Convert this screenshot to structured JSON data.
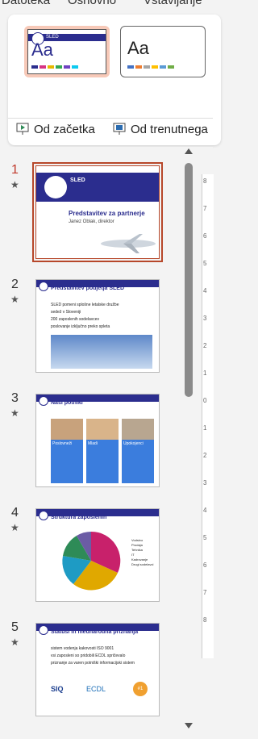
{
  "tabs": [
    "Datoteka",
    "Osnovno",
    "Vstavljanje"
  ],
  "ribbon": {
    "theme1_logo": "SLED",
    "theme_label": "Aa",
    "from_start_label": "Od začetka",
    "from_current_label": "Od trenutnega"
  },
  "colors": {
    "accent": "#2b2d8e",
    "selection": "#b7472a"
  },
  "slides": [
    {
      "num": "1",
      "title": "Predstavitev za partnerje",
      "subtitle": "Janez Oblak, direktor",
      "logo": "SLED"
    },
    {
      "num": "2",
      "title": "Predstavitev podjetja SLED",
      "bullets": [
        "SLED pomeni splošne letalske družbe",
        "sedež v Sloveniji",
        "200 zaposlenih sodelavcev",
        "poslovanje izključno preko spleta"
      ]
    },
    {
      "num": "3",
      "title": "Naši potniki",
      "cards": [
        "Poslovneži",
        "Mladi",
        "Upokojenci"
      ]
    },
    {
      "num": "4",
      "title": "Struktura zaposlenih",
      "legend": [
        "Vodstvo",
        "Prodaja",
        "Tehnika",
        "IT",
        "Kadrovanje",
        "Drugi sodelavci"
      ]
    },
    {
      "num": "5",
      "title": "Statusi in mednarodna priznanja",
      "bullets": [
        "sistem vodenja kakovosti ISO 9001",
        "vsi zaposleni so pridobili ECDL spričevalo",
        "priznanje za varen potniški informacijski sistem"
      ],
      "logos": [
        "SIQ",
        "ECDL",
        "#1"
      ]
    }
  ],
  "ruler_ticks": [
    "8",
    "7",
    "6",
    "5",
    "4",
    "3",
    "2",
    "1",
    "0",
    "1",
    "2",
    "3",
    "4",
    "5",
    "6",
    "7",
    "8"
  ]
}
